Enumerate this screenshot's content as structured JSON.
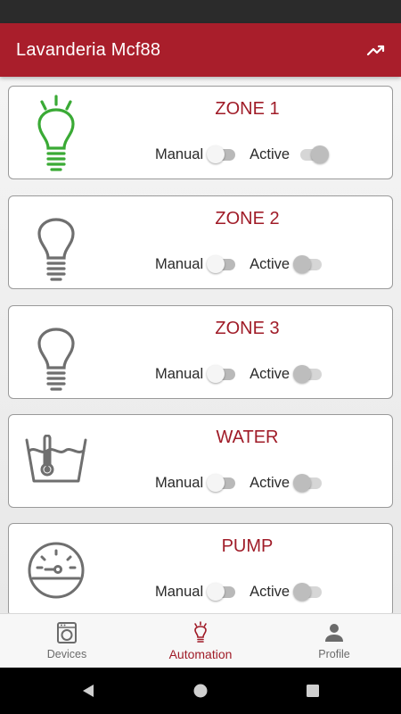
{
  "app_bar": {
    "title": "Lavanderia Mcf88",
    "action_icon": "trending-up-icon"
  },
  "colors": {
    "primary": "#a91e2b",
    "title_red": "#a01c28",
    "lit_bulb": "#3aaa35",
    "icon_gray": "#6f6f6f"
  },
  "cards": [
    {
      "title": "ZONE 1",
      "icon": "lightbulb-lit-icon",
      "manual_label": "Manual",
      "active_label": "Active",
      "manual_on": false,
      "active_on": true
    },
    {
      "title": "ZONE 2",
      "icon": "lightbulb-icon",
      "manual_label": "Manual",
      "active_label": "Active",
      "manual_on": false,
      "active_on": false
    },
    {
      "title": "ZONE 3",
      "icon": "lightbulb-icon",
      "manual_label": "Manual",
      "active_label": "Active",
      "manual_on": false,
      "active_on": false
    },
    {
      "title": "WATER",
      "icon": "water-temperature-icon",
      "manual_label": "Manual",
      "active_label": "Active",
      "manual_on": false,
      "active_on": false
    },
    {
      "title": "PUMP",
      "icon": "pump-gauge-icon",
      "manual_label": "Manual",
      "active_label": "Active",
      "manual_on": false,
      "active_on": false
    }
  ],
  "bottom_nav": {
    "items": [
      {
        "label": "Devices",
        "icon": "washing-machine-icon",
        "selected": false
      },
      {
        "label": "Automation",
        "icon": "lightbulb-lit-icon",
        "selected": true
      },
      {
        "label": "Profile",
        "icon": "person-icon",
        "selected": false
      }
    ]
  },
  "system_nav": {
    "items": [
      "back-icon",
      "home-icon",
      "recents-icon"
    ]
  }
}
